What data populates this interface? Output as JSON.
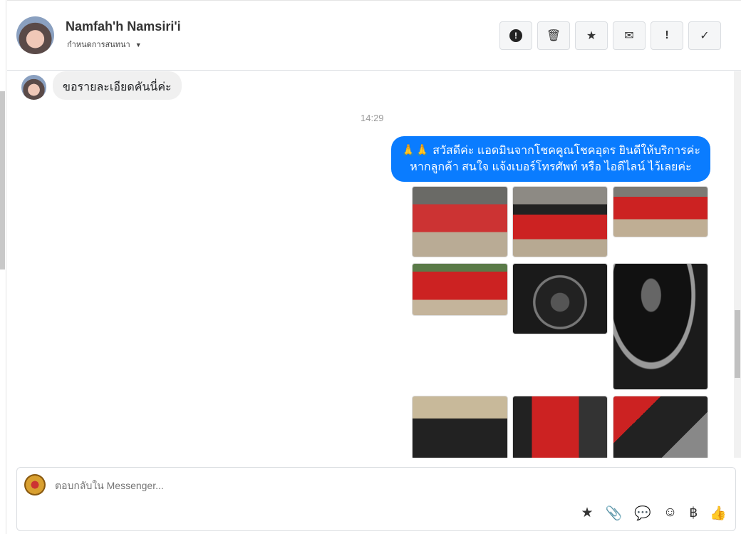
{
  "header": {
    "name": "Namfah'h Namsiri'i",
    "subtitle": "กำหนดการสนทนา",
    "dropdown_icon": "▼",
    "actions": [
      {
        "name": "report",
        "glyph": "❗"
      },
      {
        "name": "delete",
        "glyph": "🗑"
      },
      {
        "name": "star",
        "glyph": "★"
      },
      {
        "name": "mail",
        "glyph": "✉"
      },
      {
        "name": "important",
        "glyph": "!"
      },
      {
        "name": "done",
        "glyph": "✓"
      }
    ]
  },
  "messages": {
    "incoming": "ขอรายละเอียดคันนี่ค่ะ",
    "timestamp": "14:29",
    "outgoing_line1": "🙏🙏 สวัสดีค่ะ แอดมินจากโชคคูณโชคอุดร ยินดีให้บริการค่ะ",
    "outgoing_line2": "หากลูกค้า สนใจ แจ้งเบอร์โทรศัพท์ หรือ ไอดีไลน์  ไว้เลยค่ะ"
  },
  "composer": {
    "placeholder": "ตอบกลับใน Messenger...",
    "tools": [
      "★",
      "📎",
      "💬",
      "☺",
      "฿",
      "👍"
    ]
  }
}
